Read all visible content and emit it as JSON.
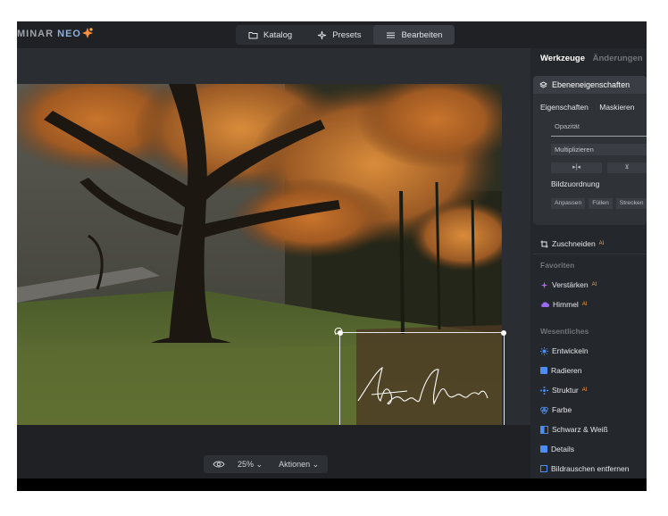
{
  "app": {
    "brand_prefix": "MINAR",
    "brand_suffix": "NEO"
  },
  "top_tabs": [
    {
      "label": "Katalog",
      "icon": "folder-icon"
    },
    {
      "label": "Presets",
      "icon": "sparkle-icon"
    },
    {
      "label": "Bearbeiten",
      "icon": "sliders-icon"
    }
  ],
  "right_panel": {
    "tabs": {
      "active": "Werkzeuge",
      "inactive": "Änderungen"
    },
    "layer_properties": {
      "title": "Ebeneneigenschaften",
      "subtabs": [
        "Eigenschaften",
        "Maskieren"
      ],
      "opacity_label": "Opazität",
      "blend_mode": "Multiplizieren",
      "flip_horizontal": "▸|◂",
      "flip_vertical": "⊻",
      "image_fit_label": "Bildzuordnung",
      "fit_options": [
        "Anpassen",
        "Füllen",
        "Strecken"
      ]
    },
    "crop_tool": "Zuschneiden",
    "ai_badge": "AI",
    "favorites_title": "Favoriten",
    "favorites": [
      "Verstärken",
      "Himmel"
    ],
    "essentials_title": "Wesentliches",
    "essentials": [
      "Entwickeln",
      "Radieren",
      "Struktur",
      "Farbe",
      "Schwarz & Weiß",
      "Details",
      "Bildrauschen entfernen"
    ]
  },
  "view_controls": {
    "zoom": "25% ⌄",
    "actions": "Aktionen ⌄"
  },
  "colors": {
    "accent_orange": "#ff9a3c",
    "accent_blue": "#4d8ef0",
    "panel_bg": "#24272b"
  }
}
